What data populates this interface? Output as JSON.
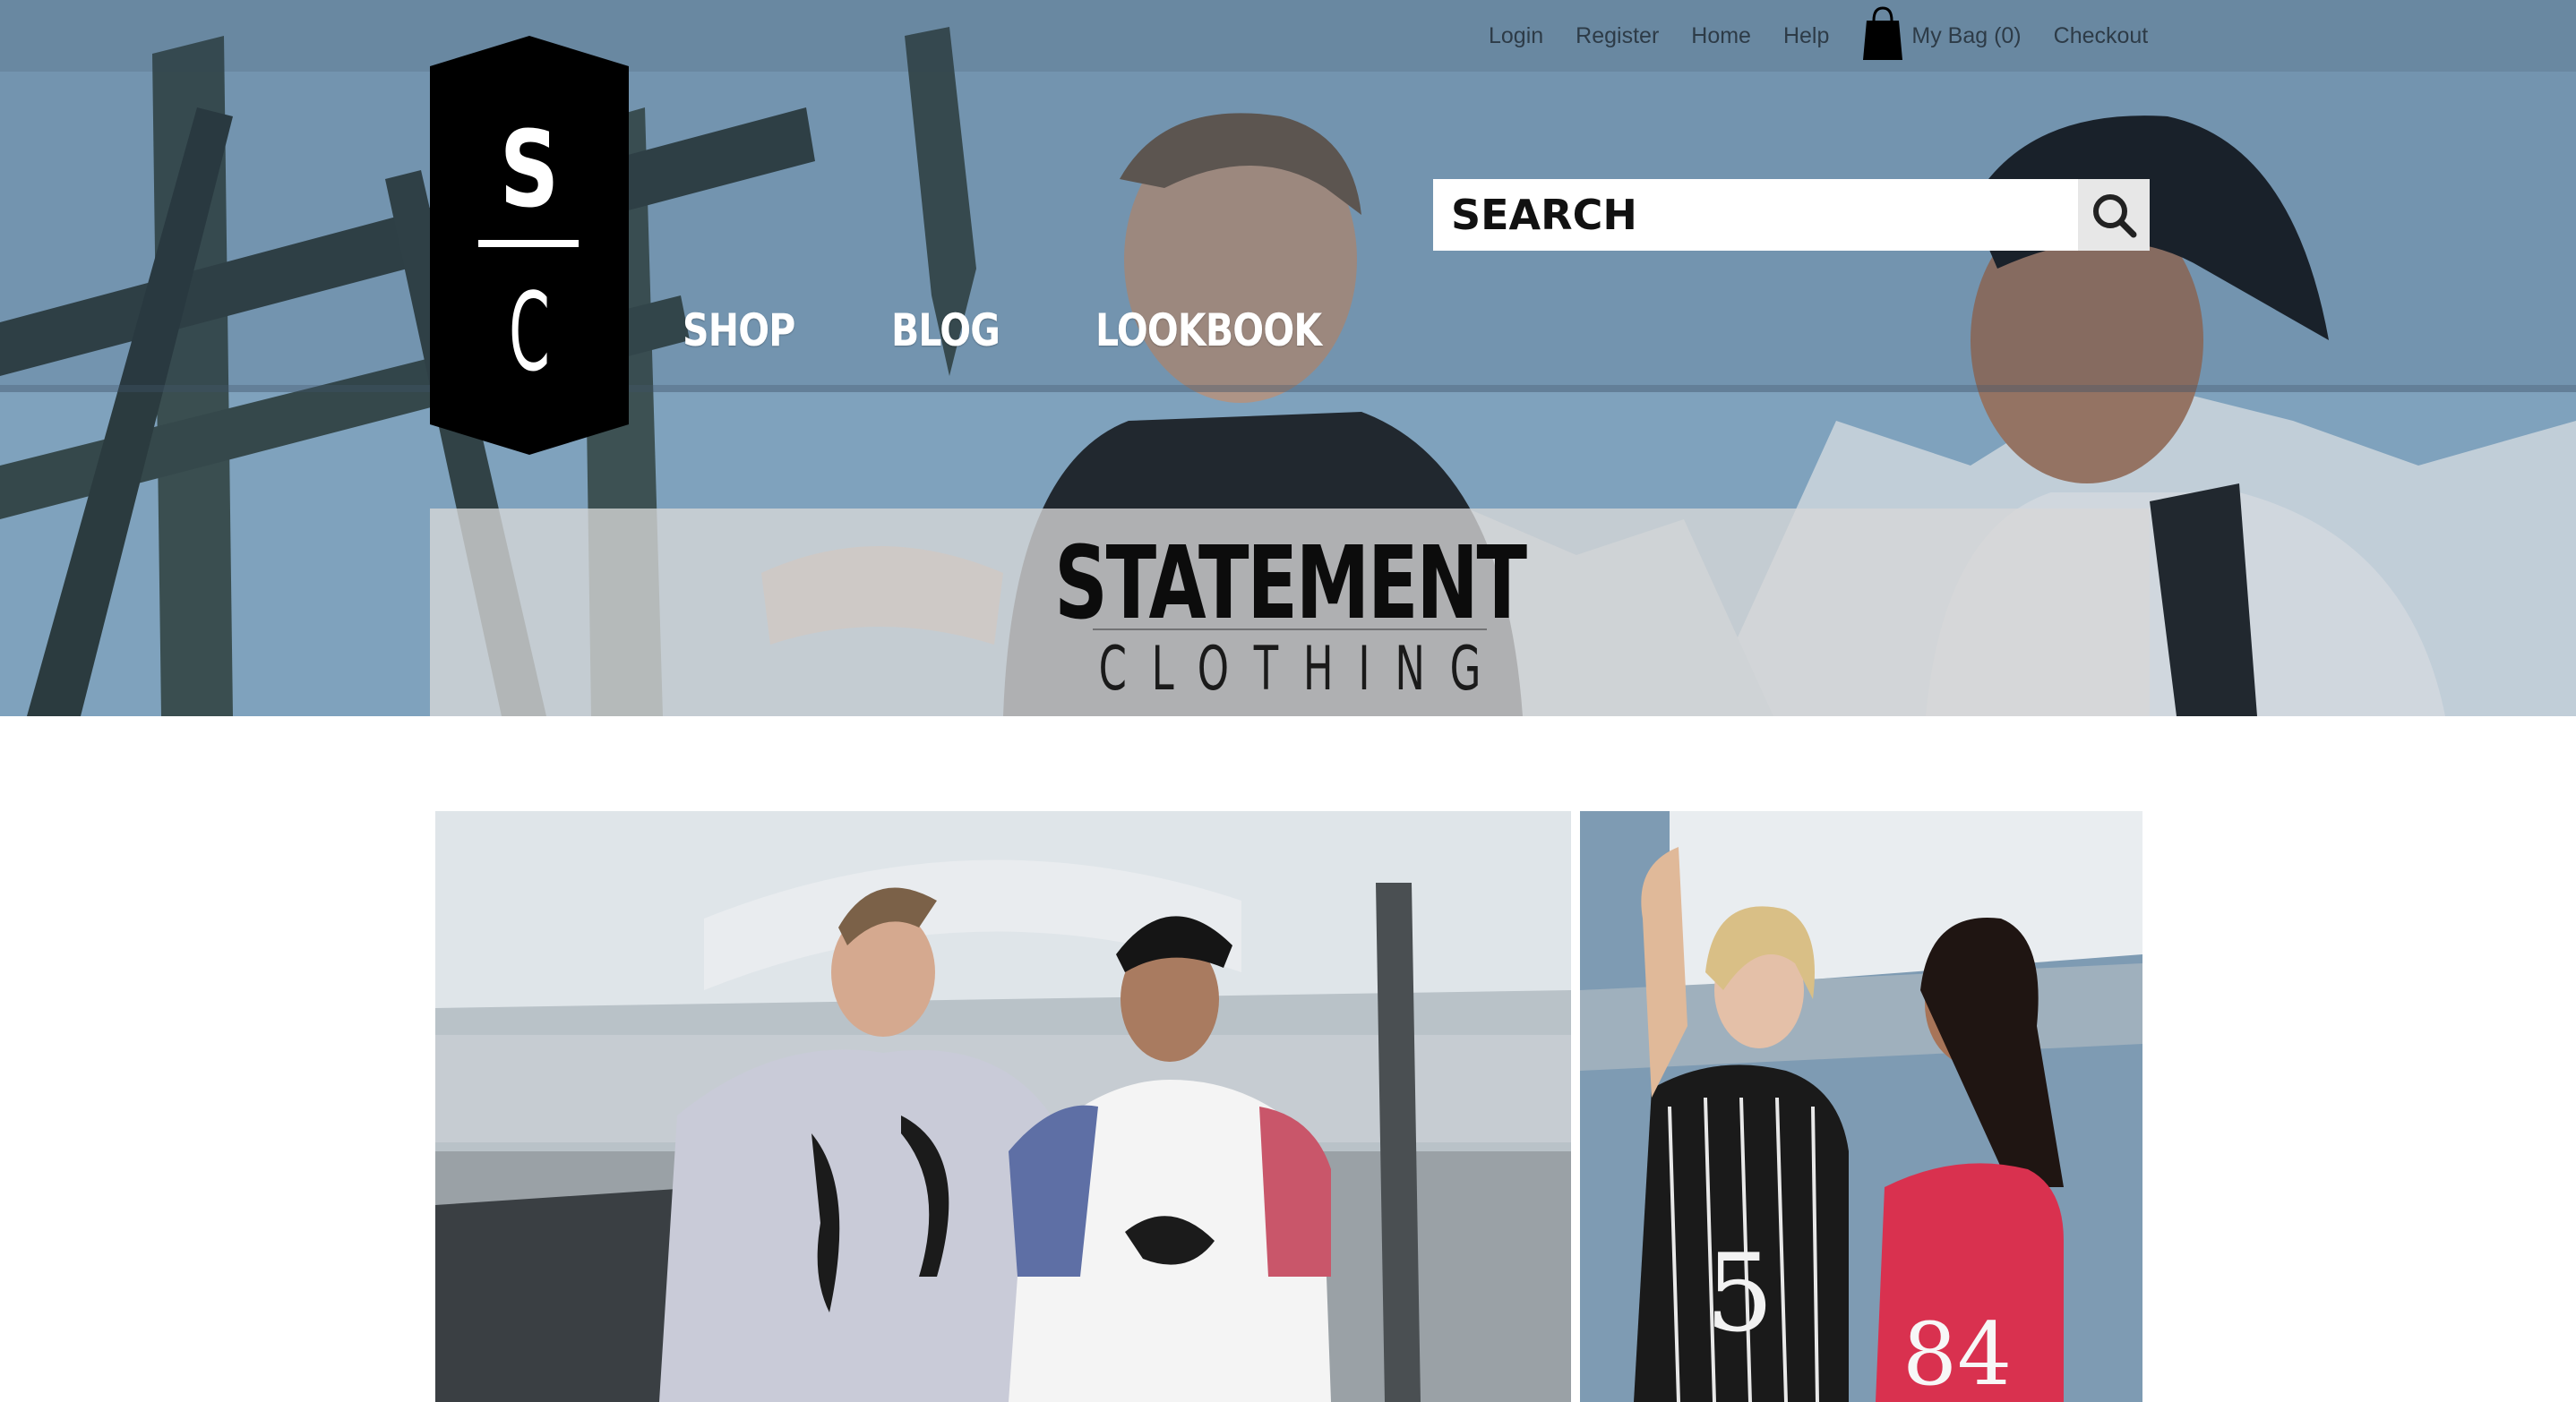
{
  "utility_nav": {
    "login": "Login",
    "register": "Register",
    "home": "Home",
    "help": "Help",
    "bag": "My Bag (0)",
    "checkout": "Checkout"
  },
  "logo": {
    "top_letter": "S",
    "bottom_letter": "C"
  },
  "main_nav": {
    "shop": "SHOP",
    "blog": "BLOG",
    "lookbook": "LOOKBOOK"
  },
  "search": {
    "placeholder": "SEARCH"
  },
  "brand": {
    "title": "STATEMENT",
    "subtitle": "CLOTHING"
  },
  "colors": {
    "badge": "#000000",
    "nav_text": "#ffffff",
    "util_text": "#2d3b47"
  },
  "icons": {
    "bag": "shopping-bag-icon",
    "search": "magnifier-icon"
  }
}
